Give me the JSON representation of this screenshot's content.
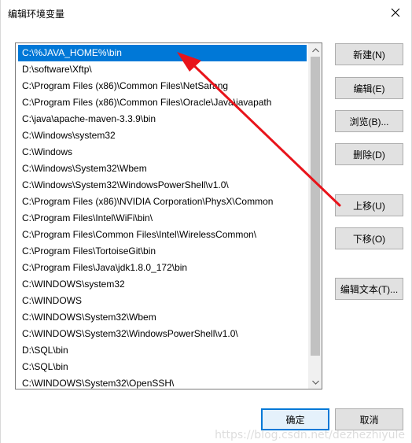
{
  "window": {
    "title": "编辑环境变量",
    "close_glyph": "✕"
  },
  "path_list": {
    "items": [
      "C:\\%JAVA_HOME%\\bin",
      "D:\\software\\Xftp\\",
      "C:\\Program Files (x86)\\Common Files\\NetSarang",
      "C:\\Program Files (x86)\\Common Files\\Oracle\\Java\\javapath",
      "C:\\java\\apache-maven-3.3.9\\bin",
      "C:\\Windows\\system32",
      "C:\\Windows",
      "C:\\Windows\\System32\\Wbem",
      "C:\\Windows\\System32\\WindowsPowerShell\\v1.0\\",
      "C:\\Program Files (x86)\\NVIDIA Corporation\\PhysX\\Common",
      "C:\\Program Files\\Intel\\WiFi\\bin\\",
      "C:\\Program Files\\Common Files\\Intel\\WirelessCommon\\",
      "C:\\Program Files\\TortoiseGit\\bin",
      "C:\\Program Files\\Java\\jdk1.8.0_172\\bin",
      "C:\\WINDOWS\\system32",
      "C:\\WINDOWS",
      "C:\\WINDOWS\\System32\\Wbem",
      "C:\\WINDOWS\\System32\\WindowsPowerShell\\v1.0\\",
      "D:\\SQL\\bin",
      "C:\\SQL\\bin",
      "C:\\WINDOWS\\System32\\OpenSSH\\"
    ],
    "selected_index": 0
  },
  "buttons": {
    "new": "新建(N)",
    "edit": "编辑(E)",
    "browse": "浏览(B)...",
    "delete": "删除(D)",
    "move_up": "上移(U)",
    "move_down": "下移(O)",
    "edit_text": "编辑文本(T)...",
    "ok": "确定",
    "cancel": "取消"
  },
  "annotation": {
    "arrow_color": "#e8141b"
  },
  "colors": {
    "selection": "#0078d7",
    "primary_border": "#0078d7"
  },
  "watermark": "https://blog.csdn.net/dezhezhiyule"
}
